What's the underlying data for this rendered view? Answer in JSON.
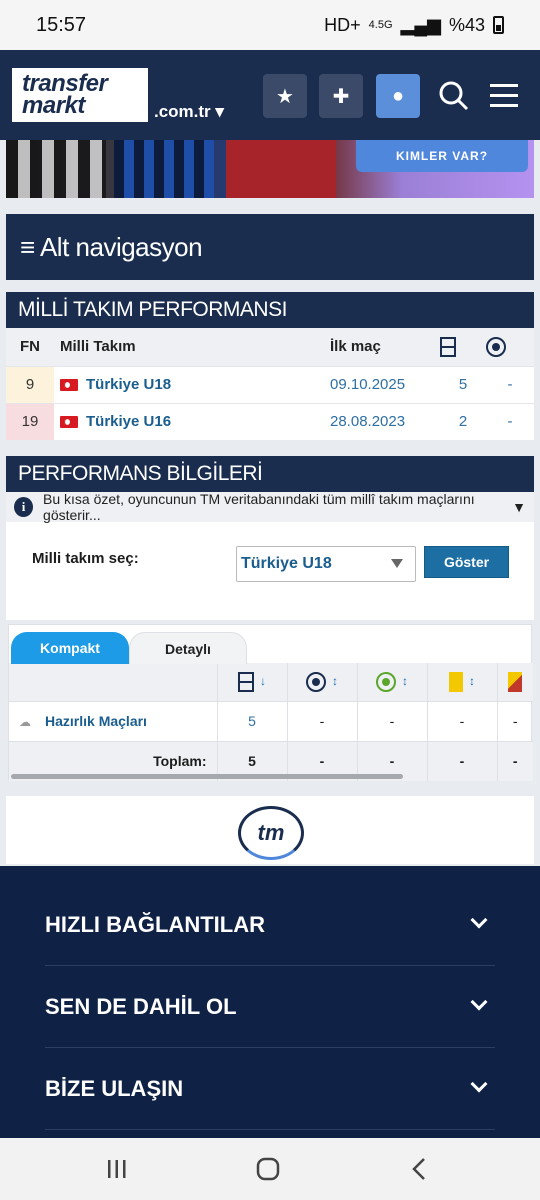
{
  "status": {
    "time": "15:57",
    "network": "4.5G",
    "battery": "%43"
  },
  "header": {
    "logo_line1": "transfer",
    "logo_line2": "markt",
    "domain": ".com.tr ▾"
  },
  "banner": {
    "cta": "KIMLER VAR?"
  },
  "alt_nav": {
    "label": "≡ Alt navigasyon"
  },
  "national_performance": {
    "title": "MİLLİ TAKIM PERFORMANSI",
    "headers": {
      "fn": "FN",
      "team": "Milli Takım",
      "first_match": "İlk maç"
    },
    "rows": [
      {
        "fn": "9",
        "team": "Türkiye U18",
        "first_match": "09.10.2025",
        "matches": "5",
        "goals": "-"
      },
      {
        "fn": "19",
        "team": "Türkiye U16",
        "first_match": "28.08.2023",
        "matches": "2",
        "goals": "-"
      }
    ]
  },
  "performance_info": {
    "title": "PERFORMANS BİLGİLERİ",
    "info_text": "Bu kısa özet, oyuncunun TM veritabanındaki tüm millî takım maçlarını gösterir...",
    "select_label": "Milli takım seç:",
    "select_value": "Türkiye U18",
    "show_button": "Göster",
    "tabs": {
      "compact": "Kompakt",
      "detailed": "Detaylı"
    },
    "rows": [
      {
        "competition": "Hazırlık Maçları",
        "apps": "5",
        "goals": "-",
        "assists": "-",
        "yellow": "-",
        "yellow_red": "-"
      }
    ],
    "total": {
      "label": "Toplam:",
      "apps": "5",
      "goals": "-",
      "assists": "-",
      "yellow": "-",
      "yellow_red": "-"
    }
  },
  "tm_logo": "tm",
  "footer": {
    "items": [
      "HIZLI BAĞLANTILAR",
      "SEN DE DAHİL OL",
      "BİZE ULAŞIN"
    ]
  }
}
